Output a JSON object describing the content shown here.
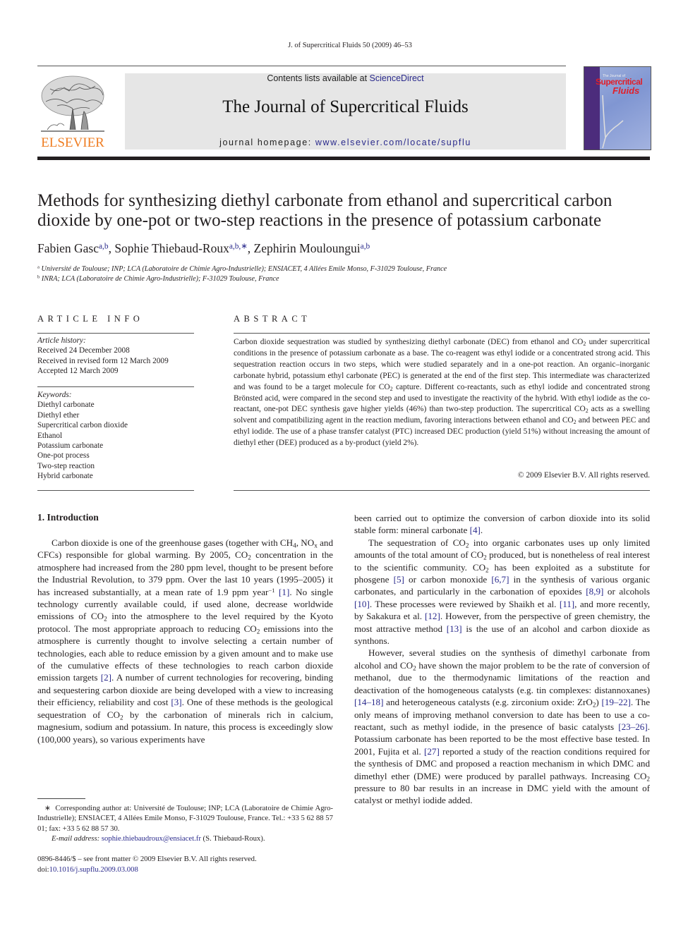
{
  "running_head": "J. of Supercritical Fluids 50 (2009) 46–53",
  "header": {
    "publisher_logo_text": "ELSEVIER",
    "contents_prefix": "Contents lists available at ",
    "contents_link": "ScienceDirect",
    "journal_title": "The Journal of Supercritical Fluids",
    "homepage_prefix": "journal homepage: ",
    "homepage_link": "www.elsevier.com/locate/supflu",
    "cover": {
      "small_text": "The Journal of",
      "title_line1": "Supercritical",
      "title_line2": "Fluids"
    },
    "colors": {
      "elsevier_orange": "#ef7d22",
      "link_blue": "#2a2a8c",
      "banner_gray": "#e6e6e6",
      "cover_red": "#e0202a"
    }
  },
  "article": {
    "title": "Methods for synthesizing diethyl carbonate from ethanol and supercritical carbon dioxide by one-pot or two-step reactions in the presence of potassium carbonate",
    "authors": [
      {
        "name": "Fabien Gasc",
        "sup": "a,b",
        "sep": ", "
      },
      {
        "name": "Sophie Thiebaud-Roux",
        "sup": "a,b,∗",
        "sep": ", "
      },
      {
        "name": "Zephirin Mouloungui",
        "sup": "a,b",
        "sep": ""
      }
    ],
    "affiliations": [
      {
        "mark": "a",
        "text": "Université de Toulouse; INP; LCA (Laboratoire de Chimie Agro-Industrielle); ENSIACET, 4 Allées Emile Monso, F-31029 Toulouse, France"
      },
      {
        "mark": "b",
        "text": "INRA; LCA (Laboratoire de Chimie Agro-Industrielle); F-31029 Toulouse, France"
      }
    ]
  },
  "article_info": {
    "heading": "ARTICLE INFO",
    "history_label": "Article history:",
    "history": [
      "Received 24 December 2008",
      "Received in revised form 12 March 2009",
      "Accepted 12 March 2009"
    ],
    "keywords_label": "Keywords:",
    "keywords": [
      "Diethyl carbonate",
      "Diethyl ether",
      "Supercritical carbon dioxide",
      "Ethanol",
      "Potassium carbonate",
      "One-pot process",
      "Two-step reaction",
      "Hybrid carbonate"
    ]
  },
  "abstract": {
    "heading": "ABSTRACT",
    "parts": [
      "Carbon dioxide sequestration was studied by synthesizing diethyl carbonate (DEC) from ethanol and CO",
      "2",
      " under supercritical conditions in the presence of potassium carbonate as a base. The co-reagent was ethyl iodide or a concentrated strong acid. This sequestration reaction occurs in two steps, which were studied separately and in a one-pot reaction. An organic–inorganic carbonate hybrid, potassium ethyl carbonate (PEC) is generated at the end of the first step. This intermediate was characterized and was found to be a target molecule for CO",
      "2",
      " capture. Different co-reactants, such as ethyl iodide and concentrated strong Brönsted acid, were compared in the second step and used to investigate the reactivity of the hybrid. With ethyl iodide as the co-reactant, one-pot DEC synthesis gave higher yields (46%) than two-step production. The supercritical CO",
      "2",
      " acts as a swelling solvent and compatibilizing agent in the reaction medium, favoring interactions between ethanol and CO",
      "2",
      " and between PEC and ethyl iodide. The use of a phase transfer catalyst (PTC) increased DEC production (yield 51%) without increasing the amount of diethyl ether (DEE) produced as a by-product (yield 2%)."
    ],
    "copyright": "© 2009 Elsevier B.V. All rights reserved."
  },
  "intro": {
    "heading": "1.  Introduction",
    "left_para": [
      "Carbon dioxide is one of the greenhouse gases (together with CH",
      "4",
      ", NO",
      "x",
      " and CFCs) responsible for global warming. By 2005, CO",
      "2",
      " concentration in the atmosphere had increased from the 280 ppm level, thought to be present before the Industrial Revolution, to 379 ppm. Over the last 10 years (1995–2005) it has increased substantially, at a mean rate of 1.9 ppm year",
      "−1",
      " ",
      "[1]",
      ". No single technology currently available could, if used alone, decrease worldwide emissions of CO",
      "2",
      " into the atmosphere to the level required by the Kyoto protocol. The most appropriate approach to reducing CO",
      "2",
      " emissions into the atmosphere is currently thought to involve selecting a certain number of technologies, each able to reduce emission by a given amount and to make use of the cumulative effects of these technologies to reach carbon dioxide emission targets ",
      "[2]",
      ". A number of current technologies for recovering, binding and sequestering carbon dioxide are being developed with a view to increasing their efficiency, reliability and cost ",
      "[3]",
      ". One of these methods is the geological sequestration of CO",
      "2",
      " by the carbonation of minerals rich in calcium, magnesium, sodium and potassium. In nature, this process is exceedingly slow (100,000 years), so various experiments have"
    ],
    "right_para1": [
      "been carried out to optimize the conversion of carbon dioxide into its solid stable form: mineral carbonate ",
      "[4]",
      "."
    ],
    "right_para2": [
      "The sequestration of CO",
      "2",
      " into organic carbonates uses up only limited amounts of the total amount of CO",
      "2",
      " produced, but is nonetheless of real interest to the scientific community. CO",
      "2",
      " has been exploited as a substitute for phosgene ",
      "[5]",
      " or carbon monoxide ",
      "[6,7]",
      " in the synthesis of various organic carbonates, and particularly in the carbonation of epoxides ",
      "[8,9]",
      " or alcohols ",
      "[10]",
      ". These processes were reviewed by Shaikh et al. ",
      "[11]",
      ", and more recently, by Sakakura et al. ",
      "[12]",
      ". However, from the perspective of green chemistry, the most attractive method ",
      "[13]",
      " is the use of an alcohol and carbon dioxide as synthons."
    ],
    "right_para3": [
      "However, several studies on the synthesis of dimethyl carbonate from alcohol and CO",
      "2",
      " have shown the major problem to be the rate of conversion of methanol, due to the thermodynamic limitations of the reaction and deactivation of the homogeneous catalysts (e.g. tin complexes: distannoxanes) ",
      "[14–18]",
      " and heterogeneous catalysts (e.g. zirconium oxide: ZrO",
      "2",
      ") ",
      "[19–22]",
      ". The only means of improving methanol conversion to date has been to use a co-reactant, such as methyl iodide, in the presence of basic catalysts ",
      "[23–26]",
      ". Potassium carbonate has been reported to be the most effective base tested. In 2001, Fujita et al. ",
      "[27]",
      " reported a study of the reaction conditions required for the synthesis of DMC and proposed a reaction mechanism in which DMC and dimethyl ether (DME) were produced by parallel pathways. Increasing CO",
      "2",
      " pressure to 80 bar results in an increase in DMC yield with the amount of catalyst or methyl iodide added."
    ]
  },
  "footnote": {
    "mark": "∗",
    "corresponding": "Corresponding author at: Université de Toulouse; INP; LCA (Laboratoire de Chimie Agro-Industrielle); ENSIACET, 4 Allées Emile Monso, F-31029 Toulouse, France. Tel.: +33 5 62 88 57 01; fax: +33 5 62 88 57 30.",
    "email_label": "E-mail address: ",
    "email": "sophie.thiebaudroux@ensiacet.fr",
    "email_suffix": " (S. Thiebaud-Roux)."
  },
  "front_matter": {
    "issn_line": "0896-8446/$ – see front matter © 2009 Elsevier B.V. All rights reserved.",
    "doi_prefix": "doi:",
    "doi": "10.1016/j.supflu.2009.03.008"
  }
}
